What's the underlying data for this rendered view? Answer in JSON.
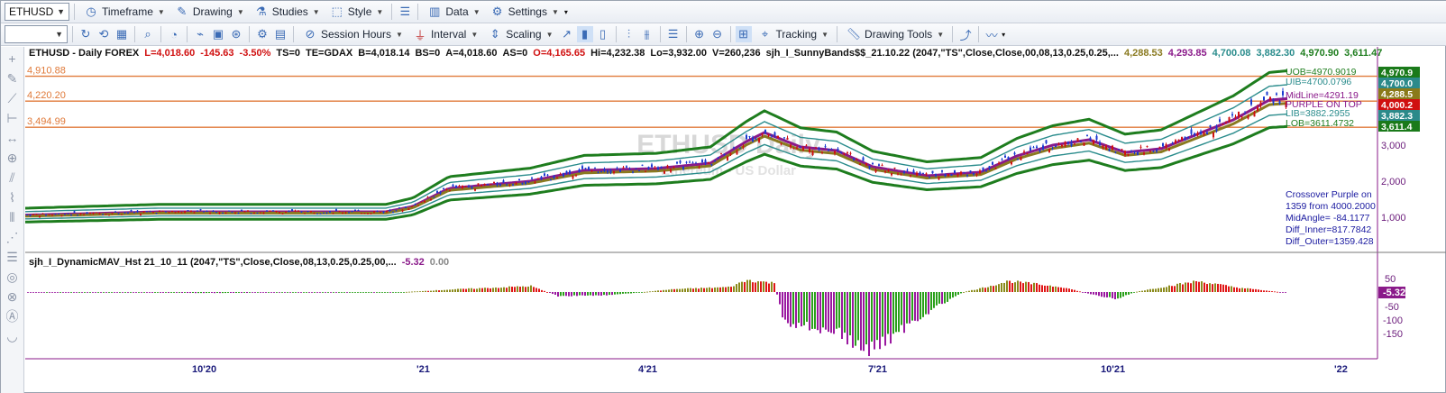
{
  "toolbar1": {
    "symbol": "ETHUSD",
    "timeframe": "Timeframe",
    "drawing": "Drawing",
    "studies": "Studies",
    "style": "Style",
    "data": "Data",
    "settings": "Settings"
  },
  "toolbar2": {
    "session_hours": "Session Hours",
    "interval": "Interval",
    "scaling": "Scaling",
    "tracking": "Tracking",
    "drawing_tools": "Drawing Tools"
  },
  "legend": {
    "symbol": "ETHUSD - Daily  FOREX",
    "last": "L=4,018.60",
    "chg": "-145.63",
    "pct": "-3.50%",
    "ts": "TS=0",
    "te": "TE=GDAX",
    "bid": "B=4,018.14",
    "bs": "BS=0",
    "ask": "A=4,018.60",
    "as": "AS=0",
    "open": "O=4,165.65",
    "hi": "Hi=4,232.38",
    "lo": "Lo=3,932.00",
    "vol": "V=260,236",
    "study": "sjh_I_SunnyBands$$_21.10.22 (2047,\"TS\",Close,Close,00,08,13,0.25,0.25,...",
    "v1": "4,288.53",
    "v2": "4,293.85",
    "v3": "4,700.08",
    "v4": "3,882.30",
    "v5": "4,970.90",
    "v6": "3,611.47"
  },
  "sublegend": {
    "study": "sjh_I_DynamicMAV_Hst 21_10_11 (2047,\"TS\",Close,Close,08,13,0.25,0.25,00,...",
    "v1": "-5.32",
    "v2": "0.00"
  },
  "watermark": {
    "title": "ETHUSD Daily",
    "subtitle": "Ethereum - US Dollar"
  },
  "hlines": [
    {
      "label": "4,910.88",
      "value": 4910.88
    },
    {
      "label": "4,220.20",
      "value": 4220.2
    },
    {
      "label": "3,494.99",
      "value": 3494.99
    }
  ],
  "band_labels": {
    "uob": "UOB=4970.9019",
    "uib": "UIB=4700.0796",
    "mid": "MidLine=4291.19",
    "purple": "PURPLE ON TOP",
    "lib": "LIB=3882.2955",
    "lob": "LOB=3611.4732"
  },
  "info_box": [
    "Crossover Purple on",
    "1359 from 4000.2000",
    "MidAngle= -84.1177",
    "Diff_Inner=817.7842",
    "Diff_Outer=1359.428"
  ],
  "price_axis": {
    "ticks": [
      "3,000",
      "2,000",
      "1,000"
    ],
    "tags": [
      {
        "text": "4,970.9",
        "color": "#1a7a1a"
      },
      {
        "text": "4,700.0",
        "color": "#2b8a8a"
      },
      {
        "text": "4,288.5",
        "color": "#8a7a1a"
      },
      {
        "text": "4,000.2",
        "color": "#d01010"
      },
      {
        "text": "3,882.3",
        "color": "#2b8a8a"
      },
      {
        "text": "3,611.4",
        "color": "#1a7a1a"
      }
    ]
  },
  "hist_axis": {
    "ticks": [
      "50",
      "-50",
      "-100",
      "-150"
    ],
    "tag": "-5.32"
  },
  "time_axis": [
    "10'20",
    "'21",
    "4'21",
    "7'21",
    "10'21",
    "'22"
  ],
  "colors": {
    "outer_band": "#1e7d1e",
    "inner_band": "#2a8c8c",
    "midline": "#8a7a20",
    "purple": "#8a1a8a",
    "hline": "#e07a3a",
    "bull": "#1a3ad0",
    "bear": "#d01010",
    "hist_pos_red": "#e01515",
    "hist_pos_olive": "#8a8a1a",
    "hist_neg_purple": "#9a18a0",
    "hist_neg_green": "#2aa01a"
  }
}
